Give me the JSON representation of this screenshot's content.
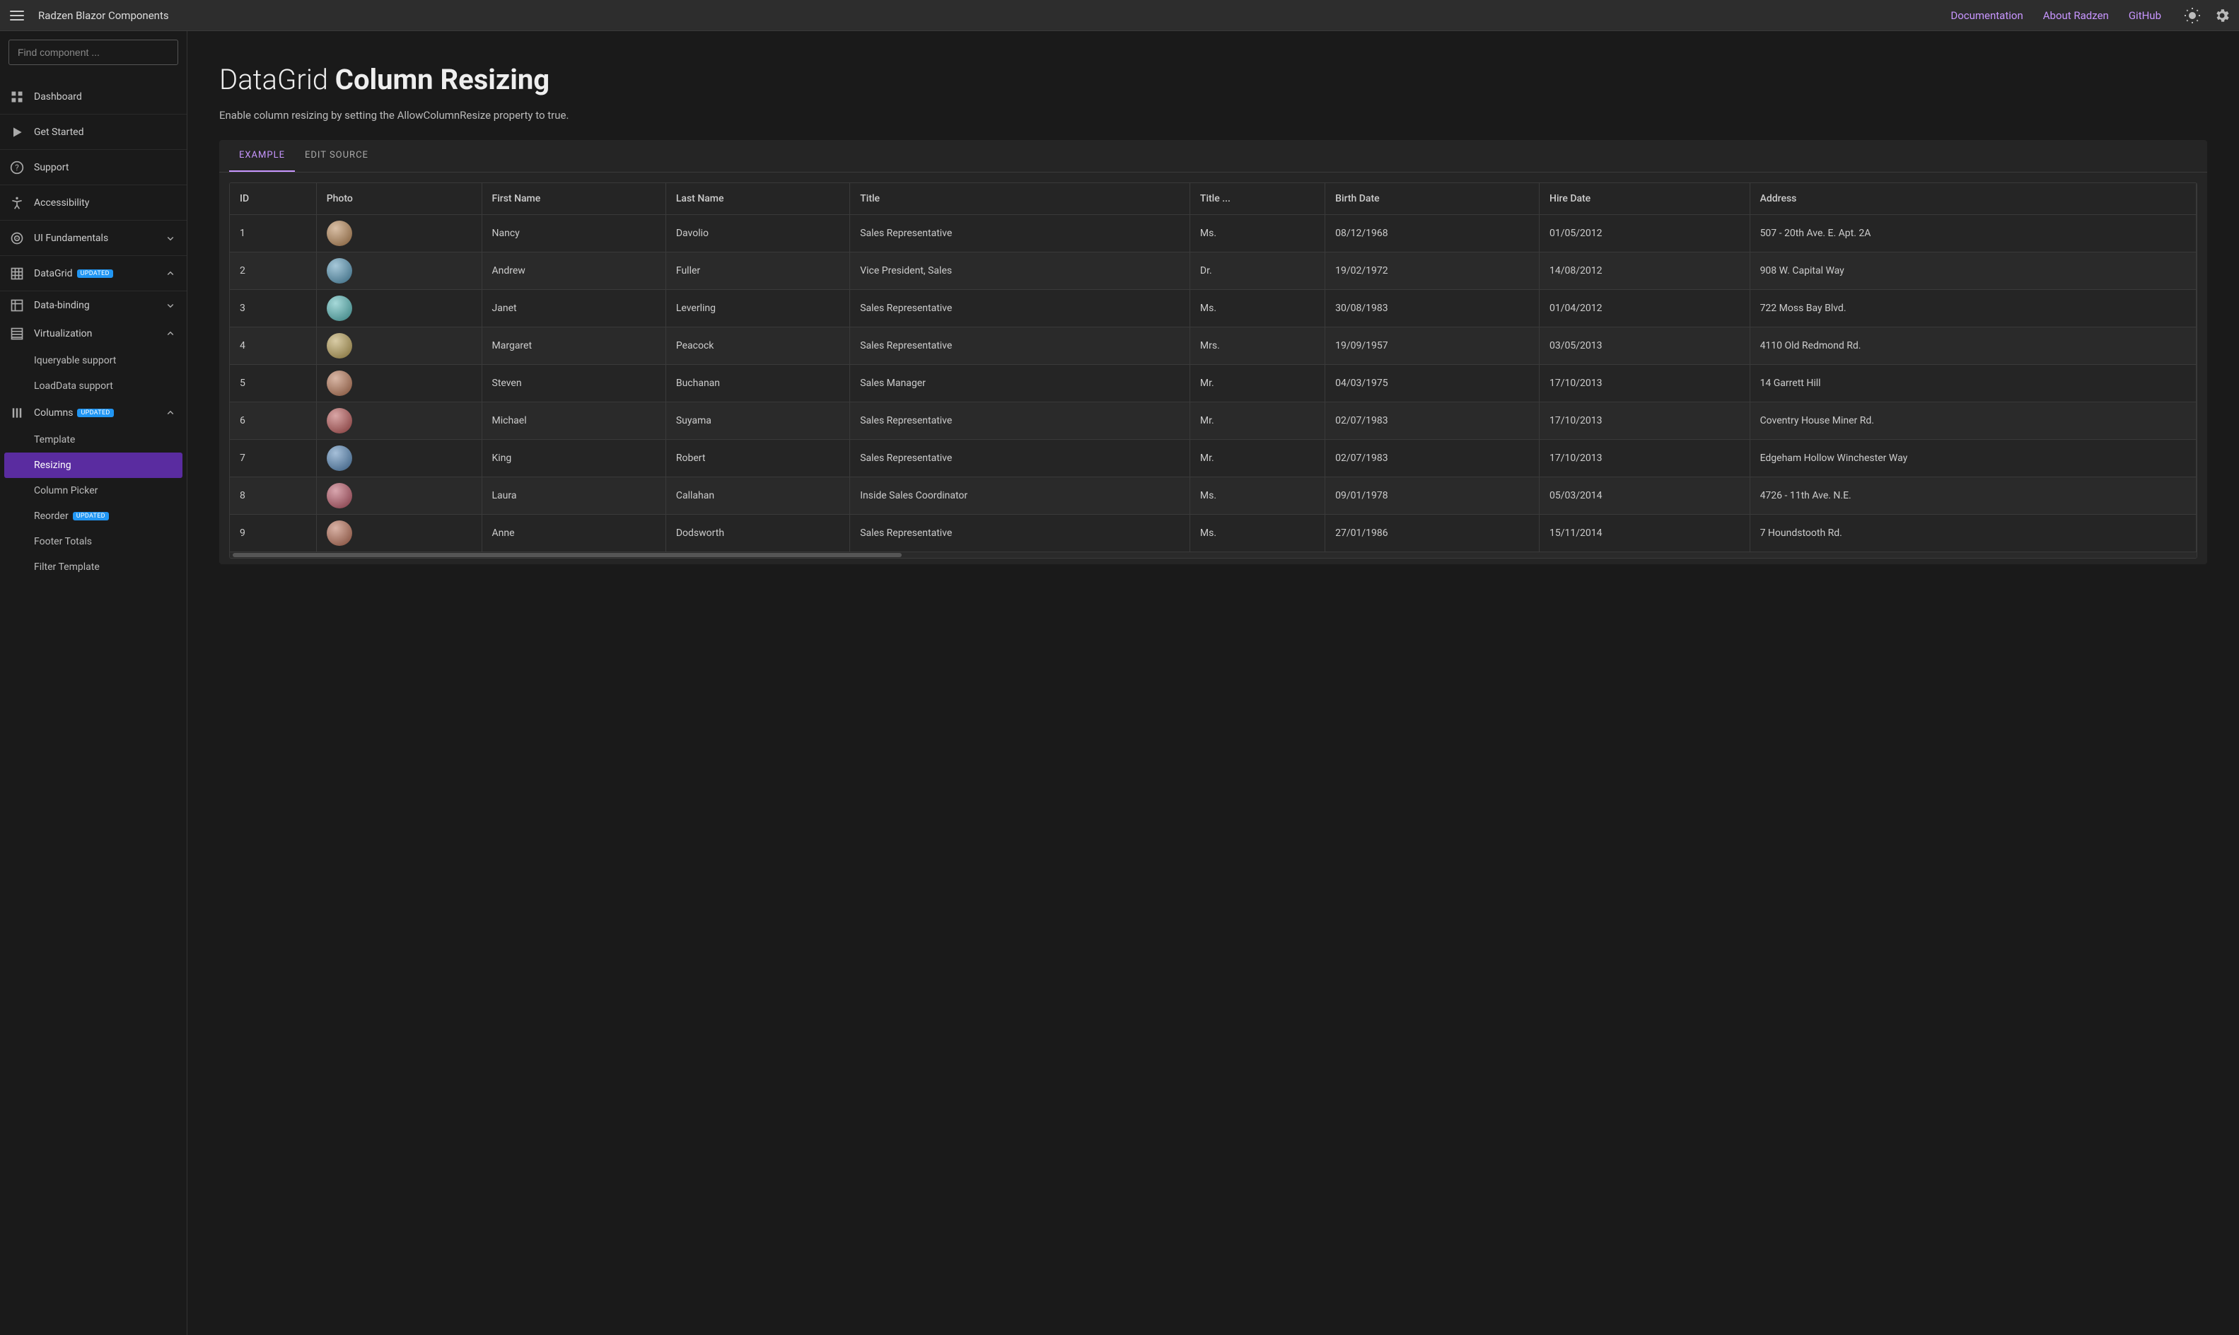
{
  "header": {
    "app_title": "Radzen Blazor Components",
    "links": [
      "Documentation",
      "About Radzen",
      "GitHub"
    ]
  },
  "sidebar": {
    "search_placeholder": "Find component ...",
    "items": [
      {
        "label": "Dashboard",
        "icon": "dashboard"
      },
      {
        "label": "Get Started",
        "icon": "play"
      },
      {
        "label": "Support",
        "icon": "help"
      },
      {
        "label": "Accessibility",
        "icon": "accessibility"
      },
      {
        "label": "UI Fundamentals",
        "icon": "target",
        "expandable": true,
        "expanded": false
      },
      {
        "label": "DataGrid",
        "icon": "grid",
        "badge": "UPDATED",
        "expandable": true,
        "expanded": true,
        "children": [
          {
            "label": "Data-binding",
            "icon": "table",
            "expandable": true,
            "expanded": false
          },
          {
            "label": "Virtualization",
            "icon": "virt",
            "expandable": true,
            "expanded": true,
            "children": [
              {
                "label": "Iqueryable support"
              },
              {
                "label": "LoadData support"
              }
            ]
          },
          {
            "label": "Columns",
            "icon": "columns",
            "badge": "UPDATED",
            "expandable": true,
            "expanded": true,
            "children": [
              {
                "label": "Template"
              },
              {
                "label": "Resizing",
                "active": true
              },
              {
                "label": "Column Picker"
              },
              {
                "label": "Reorder",
                "badge": "UPDATED"
              },
              {
                "label": "Footer Totals"
              },
              {
                "label": "Filter Template"
              }
            ]
          }
        ]
      }
    ]
  },
  "page": {
    "title_light": "DataGrid ",
    "title_bold": "Column Resizing",
    "subtitle": "Enable column resizing by setting the AllowColumnResize property to true.",
    "tabs": [
      "EXAMPLE",
      "EDIT SOURCE"
    ],
    "active_tab": 0
  },
  "grid": {
    "columns": [
      "ID",
      "Photo",
      "First Name",
      "Last Name",
      "Title",
      "Title ...",
      "Birth Date",
      "Hire Date",
      "Address"
    ],
    "rows": [
      {
        "id": "1",
        "photo_hue": 30,
        "first": "Nancy",
        "last": "Davolio",
        "title": "Sales Representative",
        "toc": "Ms.",
        "birth": "08/12/1968",
        "hire": "01/05/2012",
        "address": "507 - 20th Ave. E. Apt. 2A"
      },
      {
        "id": "2",
        "photo_hue": 200,
        "first": "Andrew",
        "last": "Fuller",
        "title": "Vice President, Sales",
        "toc": "Dr.",
        "birth": "19/02/1972",
        "hire": "14/08/2012",
        "address": "908 W. Capital Way"
      },
      {
        "id": "3",
        "photo_hue": 180,
        "first": "Janet",
        "last": "Leverling",
        "title": "Sales Representative",
        "toc": "Ms.",
        "birth": "30/08/1983",
        "hire": "01/04/2012",
        "address": "722 Moss Bay Blvd."
      },
      {
        "id": "4",
        "photo_hue": 45,
        "first": "Margaret",
        "last": "Peacock",
        "title": "Sales Representative",
        "toc": "Mrs.",
        "birth": "19/09/1957",
        "hire": "03/05/2013",
        "address": "4110 Old Redmond Rd."
      },
      {
        "id": "5",
        "photo_hue": 20,
        "first": "Steven",
        "last": "Buchanan",
        "title": "Sales Manager",
        "toc": "Mr.",
        "birth": "04/03/1975",
        "hire": "17/10/2013",
        "address": "14 Garrett Hill"
      },
      {
        "id": "6",
        "photo_hue": 0,
        "first": "Michael",
        "last": "Suyama",
        "title": "Sales Representative",
        "toc": "Mr.",
        "birth": "02/07/1983",
        "hire": "17/10/2013",
        "address": "Coventry House Miner Rd."
      },
      {
        "id": "7",
        "photo_hue": 210,
        "first": "King",
        "last": "Robert",
        "title": "Sales Representative",
        "toc": "Mr.",
        "birth": "02/07/1983",
        "hire": "17/10/2013",
        "address": "Edgeham Hollow Winchester Way"
      },
      {
        "id": "8",
        "photo_hue": 350,
        "first": "Laura",
        "last": "Callahan",
        "title": "Inside Sales Coordinator",
        "toc": "Ms.",
        "birth": "09/01/1978",
        "hire": "05/03/2014",
        "address": "4726 - 11th Ave. N.E."
      },
      {
        "id": "9",
        "photo_hue": 15,
        "first": "Anne",
        "last": "Dodsworth",
        "title": "Sales Representative",
        "toc": "Ms.",
        "birth": "27/01/1986",
        "hire": "15/11/2014",
        "address": "7 Houndstooth Rd."
      }
    ]
  }
}
